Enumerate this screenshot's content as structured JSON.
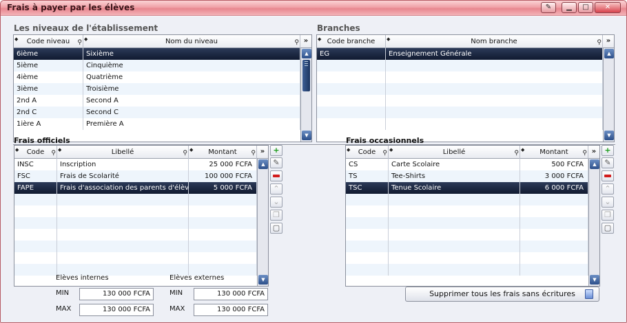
{
  "window": {
    "title": "Frais à payer par les élèves",
    "buttons": [
      "tools",
      "minimize",
      "maximize",
      "close"
    ]
  },
  "niveaux": {
    "title": "Les niveaux de l'établissement",
    "columns": [
      "Code niveau",
      "Nom du niveau"
    ],
    "rows": [
      [
        "6ième",
        "Sixième"
      ],
      [
        "5ième",
        "Cinquième"
      ],
      [
        "4ième",
        "Quatrième"
      ],
      [
        "3ième",
        "Troisième"
      ],
      [
        "2nd A",
        "Second A"
      ],
      [
        "2nd C",
        "Second C"
      ],
      [
        "1ière A",
        "Première A"
      ]
    ],
    "selected_index": 0
  },
  "branches": {
    "title": "Branches",
    "columns": [
      "Code branche",
      "Nom branche"
    ],
    "rows": [
      [
        "EG",
        "Enseignement Générale"
      ]
    ],
    "selected_index": 0
  },
  "officiels": {
    "title": "Frais officiels",
    "columns": [
      "Code",
      "Libellé",
      "Montant"
    ],
    "rows": [
      [
        "INSC",
        "Inscription",
        "25 000 FCFA"
      ],
      [
        "FSC",
        "Frais de Scolarité",
        "100 000 FCFA"
      ],
      [
        "FAPE",
        "Frais d'association des parents d'élèves",
        "5 000 FCFA"
      ]
    ],
    "selected_index": 2
  },
  "occasionnels": {
    "title": "Frais occasionnels",
    "columns": [
      "Code",
      "Libellé",
      "Montant"
    ],
    "rows": [
      [
        "CS",
        "Carte Scolaire",
        "500 FCFA"
      ],
      [
        "TS",
        "Tee-Shirts",
        "3 000 FCFA"
      ],
      [
        "TSC",
        "Tenue Scolaire",
        "6 000 FCFA"
      ]
    ],
    "selected_index": 2
  },
  "totals": {
    "internes_label": "Elèves internes",
    "externes_label": "Elèves externes",
    "min_label": "MIN",
    "max_label": "MAX",
    "internes_min": "130 000 FCFA",
    "internes_max": "130 000 FCFA",
    "externes_min": "130 000 FCFA",
    "externes_max": "130 000 FCFA"
  },
  "actions": {
    "delete_all_label": "Supprimer tous les frais sans écritures"
  },
  "icons": {
    "sort": "sort-diamond-icon",
    "search": "search-key-icon",
    "expand": "expand-chevrons-icon",
    "add": "plus-icon",
    "edit": "edit-icon",
    "delete": "minus-icon",
    "move_up": "move-up-icon",
    "move_down": "move-down-icon",
    "copy": "copy-icon",
    "paste": "paste-icon",
    "trash": "trash-icon"
  },
  "colors": {
    "title_bar": "#f0a2a8",
    "selection": "#1a2640",
    "alt_row": "#eef5fc"
  }
}
